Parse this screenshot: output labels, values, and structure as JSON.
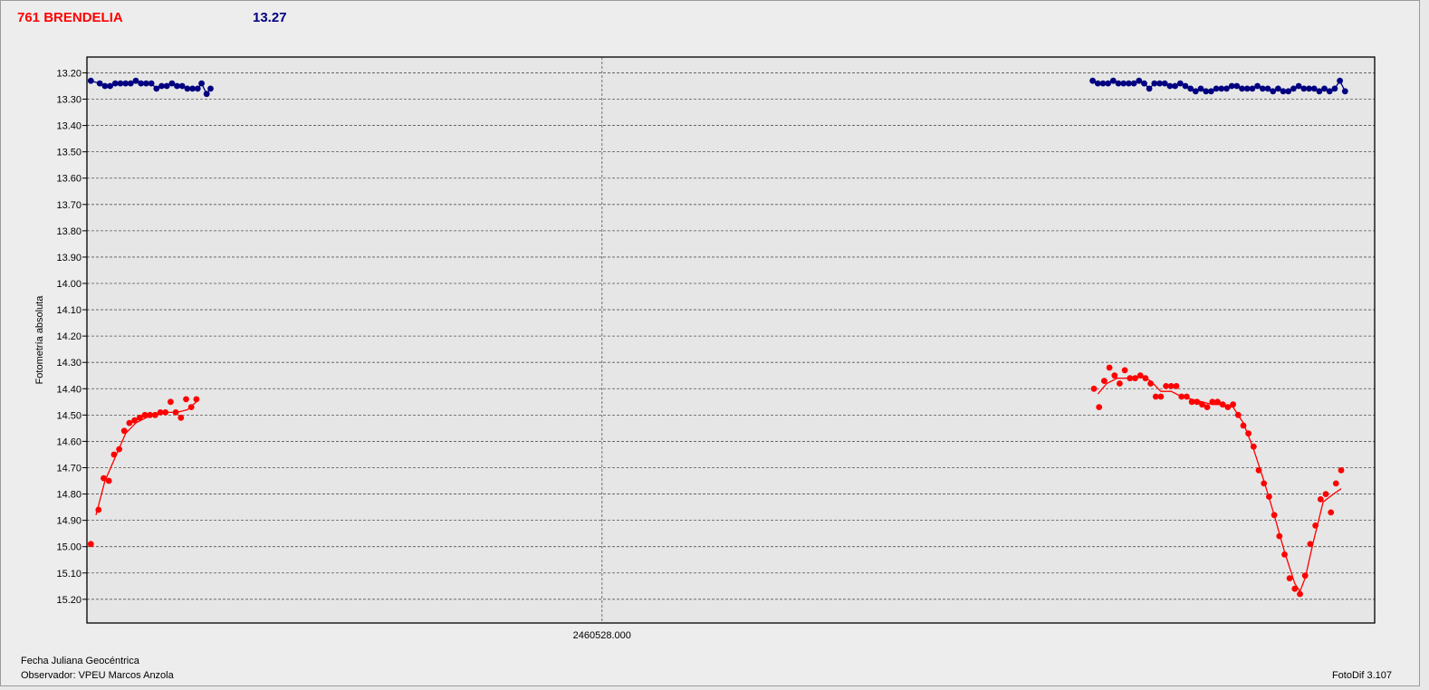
{
  "header": {
    "object": "761 BRENDELIA",
    "reference_mag": "13.27",
    "object_color": "#ff0000",
    "reference_color": "#000080"
  },
  "footer": {
    "xlabel": "Fecha Juliana Geocéntrica",
    "observer": "Observador: VPEU Marcos Anzola",
    "version": "FotoDif 3.107"
  },
  "chart_data": {
    "type": "scatter",
    "ylabel": "Fotometría absoluta",
    "y_inverted": true,
    "ylim": [
      15.29,
      13.14
    ],
    "yticks": [
      "13.20",
      "13.30",
      "13.40",
      "13.50",
      "13.60",
      "13.70",
      "13.80",
      "13.90",
      "14.00",
      "14.10",
      "14.20",
      "14.30",
      "14.40",
      "14.50",
      "14.60",
      "14.70",
      "14.80",
      "14.90",
      "15.00",
      "15.10",
      "15.20"
    ],
    "xlim": [
      0,
      1000
    ],
    "xticks": [
      {
        "x": 400,
        "label": "2460528.000"
      }
    ],
    "grid": true,
    "series": [
      {
        "role": "reference",
        "color": "#000080",
        "points": [
          [
            3,
            13.23
          ],
          [
            10,
            13.24
          ],
          [
            14,
            13.25
          ],
          [
            18,
            13.25
          ],
          [
            22,
            13.24
          ],
          [
            26,
            13.24
          ],
          [
            30,
            13.24
          ],
          [
            34,
            13.24
          ],
          [
            38,
            13.23
          ],
          [
            42,
            13.24
          ],
          [
            46,
            13.24
          ],
          [
            50,
            13.24
          ],
          [
            54,
            13.26
          ],
          [
            58,
            13.25
          ],
          [
            62,
            13.25
          ],
          [
            66,
            13.24
          ],
          [
            70,
            13.25
          ],
          [
            74,
            13.25
          ],
          [
            78,
            13.26
          ],
          [
            82,
            13.26
          ],
          [
            86,
            13.26
          ],
          [
            89,
            13.24
          ],
          [
            93,
            13.28
          ],
          [
            96,
            13.26
          ],
          [
            781,
            13.23
          ],
          [
            785,
            13.24
          ],
          [
            789,
            13.24
          ],
          [
            793,
            13.24
          ],
          [
            797,
            13.23
          ],
          [
            801,
            13.24
          ],
          [
            805,
            13.24
          ],
          [
            809,
            13.24
          ],
          [
            813,
            13.24
          ],
          [
            817,
            13.23
          ],
          [
            821,
            13.24
          ],
          [
            825,
            13.26
          ],
          [
            829,
            13.24
          ],
          [
            833,
            13.24
          ],
          [
            837,
            13.24
          ],
          [
            841,
            13.25
          ],
          [
            845,
            13.25
          ],
          [
            849,
            13.24
          ],
          [
            853,
            13.25
          ],
          [
            857,
            13.26
          ],
          [
            861,
            13.27
          ],
          [
            865,
            13.26
          ],
          [
            869,
            13.27
          ],
          [
            873,
            13.27
          ],
          [
            877,
            13.26
          ],
          [
            881,
            13.26
          ],
          [
            885,
            13.26
          ],
          [
            889,
            13.25
          ],
          [
            893,
            13.25
          ],
          [
            897,
            13.26
          ],
          [
            901,
            13.26
          ],
          [
            905,
            13.26
          ],
          [
            909,
            13.25
          ],
          [
            913,
            13.26
          ],
          [
            917,
            13.26
          ],
          [
            921,
            13.27
          ],
          [
            925,
            13.26
          ],
          [
            929,
            13.27
          ],
          [
            933,
            13.27
          ],
          [
            937,
            13.26
          ],
          [
            941,
            13.25
          ],
          [
            945,
            13.26
          ],
          [
            949,
            13.26
          ],
          [
            953,
            13.26
          ],
          [
            957,
            13.27
          ],
          [
            961,
            13.26
          ],
          [
            965,
            13.27
          ],
          [
            969,
            13.26
          ],
          [
            973,
            13.23
          ],
          [
            977,
            13.27
          ]
        ]
      },
      {
        "role": "target",
        "color": "#ff0000",
        "points": [
          [
            3,
            14.99
          ],
          [
            9,
            14.86
          ],
          [
            13,
            14.74
          ],
          [
            17,
            14.75
          ],
          [
            21,
            14.65
          ],
          [
            25,
            14.63
          ],
          [
            29,
            14.56
          ],
          [
            33,
            14.53
          ],
          [
            37,
            14.52
          ],
          [
            41,
            14.51
          ],
          [
            45,
            14.5
          ],
          [
            49,
            14.5
          ],
          [
            53,
            14.5
          ],
          [
            57,
            14.49
          ],
          [
            61,
            14.49
          ],
          [
            65,
            14.45
          ],
          [
            69,
            14.49
          ],
          [
            73,
            14.51
          ],
          [
            77,
            14.44
          ],
          [
            81,
            14.47
          ],
          [
            85,
            14.44
          ],
          [
            782,
            14.4
          ],
          [
            786,
            14.47
          ],
          [
            790,
            14.37
          ],
          [
            794,
            14.32
          ],
          [
            798,
            14.35
          ],
          [
            802,
            14.38
          ],
          [
            806,
            14.33
          ],
          [
            810,
            14.36
          ],
          [
            814,
            14.36
          ],
          [
            818,
            14.35
          ],
          [
            822,
            14.36
          ],
          [
            826,
            14.38
          ],
          [
            830,
            14.43
          ],
          [
            834,
            14.43
          ],
          [
            838,
            14.39
          ],
          [
            842,
            14.39
          ],
          [
            846,
            14.39
          ],
          [
            850,
            14.43
          ],
          [
            854,
            14.43
          ],
          [
            858,
            14.45
          ],
          [
            862,
            14.45
          ],
          [
            866,
            14.46
          ],
          [
            870,
            14.47
          ],
          [
            874,
            14.45
          ],
          [
            878,
            14.45
          ],
          [
            882,
            14.46
          ],
          [
            886,
            14.47
          ],
          [
            890,
            14.46
          ],
          [
            894,
            14.5
          ],
          [
            898,
            14.54
          ],
          [
            902,
            14.57
          ],
          [
            906,
            14.62
          ],
          [
            910,
            14.71
          ],
          [
            914,
            14.76
          ],
          [
            918,
            14.81
          ],
          [
            922,
            14.88
          ],
          [
            926,
            14.96
          ],
          [
            930,
            15.03
          ],
          [
            934,
            15.12
          ],
          [
            938,
            15.16
          ],
          [
            942,
            15.18
          ],
          [
            946,
            15.11
          ],
          [
            950,
            14.99
          ],
          [
            954,
            14.92
          ],
          [
            958,
            14.82
          ],
          [
            962,
            14.8
          ],
          [
            966,
            14.87
          ],
          [
            970,
            14.76
          ],
          [
            974,
            14.71
          ]
        ],
        "curve": [
          [
            7,
            14.88
          ],
          [
            14,
            14.75
          ],
          [
            22,
            14.66
          ],
          [
            30,
            14.57
          ],
          [
            38,
            14.53
          ],
          [
            46,
            14.51
          ],
          [
            54,
            14.5
          ],
          [
            62,
            14.49
          ],
          [
            70,
            14.49
          ],
          [
            78,
            14.48
          ],
          [
            85,
            14.45
          ],
          [
            785,
            14.42
          ],
          [
            792,
            14.38
          ],
          [
            800,
            14.36
          ],
          [
            810,
            14.36
          ],
          [
            818,
            14.35
          ],
          [
            826,
            14.37
          ],
          [
            834,
            14.41
          ],
          [
            842,
            14.41
          ],
          [
            850,
            14.43
          ],
          [
            858,
            14.44
          ],
          [
            866,
            14.45
          ],
          [
            874,
            14.46
          ],
          [
            882,
            14.46
          ],
          [
            890,
            14.47
          ],
          [
            898,
            14.53
          ],
          [
            906,
            14.63
          ],
          [
            914,
            14.75
          ],
          [
            922,
            14.88
          ],
          [
            930,
            15.02
          ],
          [
            938,
            15.14
          ],
          [
            942,
            15.17
          ],
          [
            946,
            15.12
          ],
          [
            952,
            14.99
          ],
          [
            960,
            14.83
          ],
          [
            968,
            14.8
          ],
          [
            974,
            14.78
          ]
        ]
      }
    ]
  }
}
